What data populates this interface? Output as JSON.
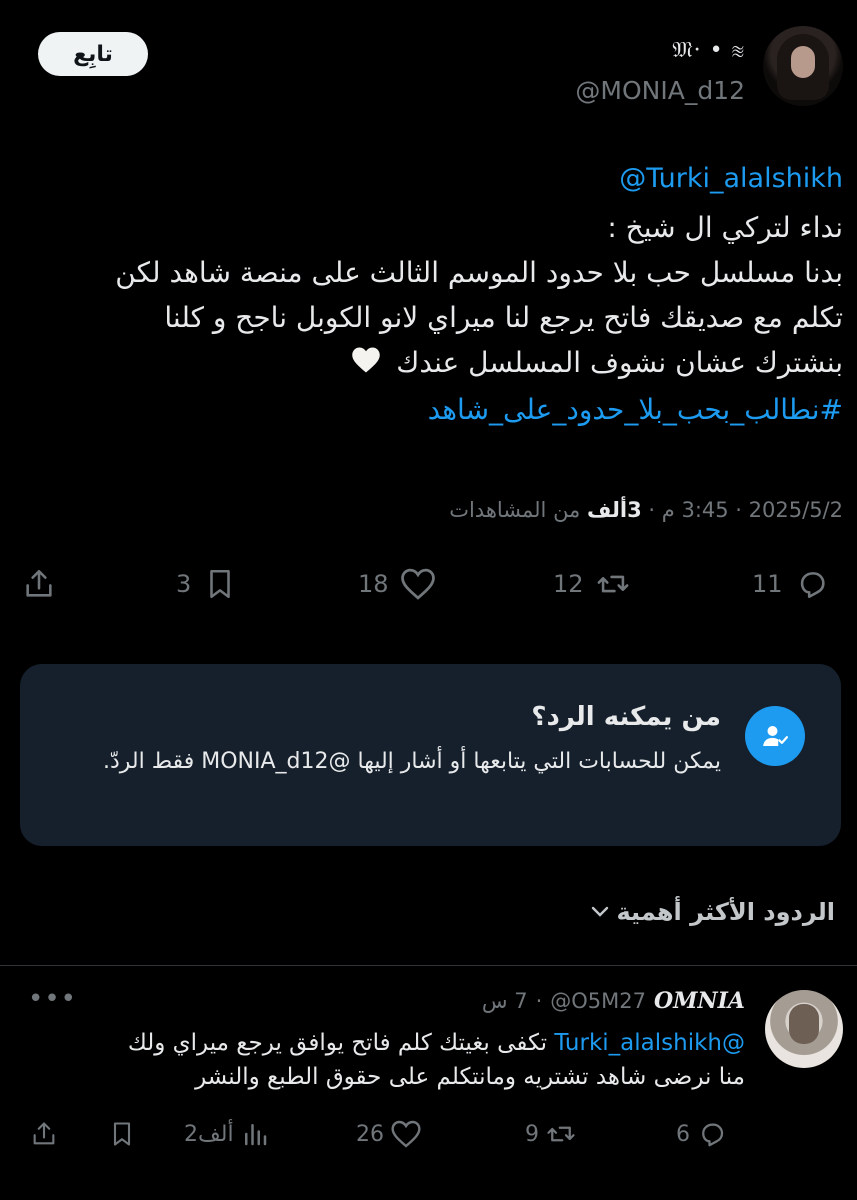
{
  "header": {
    "display_name": "𝔐·",
    "name_suffix": "• ≋",
    "handle": "@MONIA_d12",
    "follow_label": "تابِع"
  },
  "tweet": {
    "mention": "@Turki_alalshikh",
    "lines": [
      "نداء لتركي ال شيخ :",
      "بدنا مسلسل حب بلا حدود الموسم الثالث على منصة شاهد لكن",
      "تكلم مع صديقك فاتح يرجع لنا ميراي لانو الكوبل ناجح و كلنا",
      "بنشترك عشان نشوف المسلسل عندك"
    ],
    "hashtag": "#نطالب_بحب_بلا_حدود_على_شاهد",
    "date": "2025/5/2",
    "time": "3:45 م",
    "views_count": "3ألف",
    "views_label": "من المشاهدات"
  },
  "actions": {
    "replies": "11",
    "retweets": "12",
    "likes": "18",
    "bookmarks": "3"
  },
  "reply_card": {
    "title": "من يمكنه الرد؟",
    "text": "يمكن للحسابات التي يتابعها أو أشار إليها @MONIA_d12 فقط الردّ."
  },
  "sort": {
    "label": "الردود الأكثر أهمية"
  },
  "reply": {
    "name": "OMNIA",
    "handle": "@O5M27",
    "time": "7 س",
    "mention": "@Turki_alalshikh",
    "line1_text": "تكفى بغيتك كلم فاتح يوافق يرجع ميراي ولك",
    "line2": "منا نرضى شاهد تشتريه ومانتكلم على حقوق الطبع والنشر",
    "replies": "6",
    "retweets": "9",
    "likes": "26",
    "views": "2ألف"
  },
  "colors": {
    "accent": "#1d9bf0",
    "muted": "#71767b",
    "card": "#16202c"
  }
}
